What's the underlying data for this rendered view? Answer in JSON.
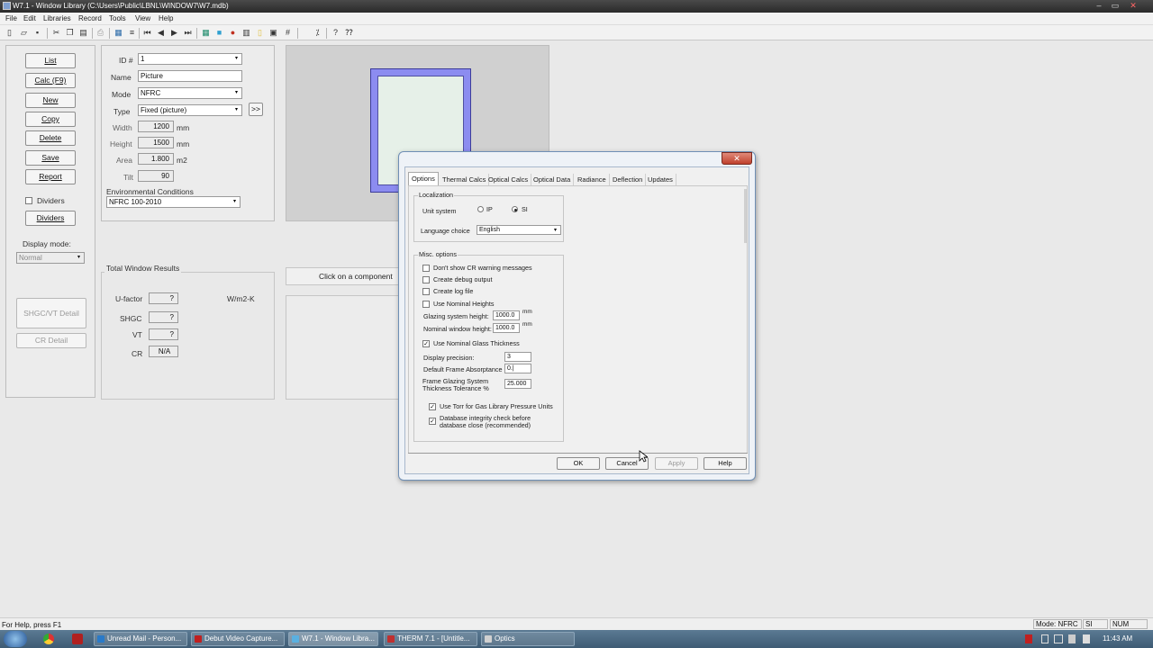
{
  "window": {
    "title": "W7.1 - Window Library (C:\\Users\\Public\\LBNL\\WINDOW7\\W7.mdb)"
  },
  "menu": [
    "File",
    "Edit",
    "Libraries",
    "Record",
    "Tools",
    "View",
    "Help"
  ],
  "toolbar": {
    "icons": [
      "new-icon",
      "open-icon",
      "save-icon",
      "cut-icon",
      "copy-icon",
      "paste-icon",
      "print-icon",
      "grid-icon",
      "list-icon",
      "first-icon",
      "prev-icon",
      "next-icon",
      "last-icon",
      "table-icon",
      "square-icon",
      "red-dot-icon",
      "bars-icon",
      "page-icon",
      "frame-icon",
      "hash-icon",
      "percent-icon",
      "help-icon",
      "context-help-icon"
    ]
  },
  "left_buttons": {
    "list": "List",
    "calc": "Calc (F9)",
    "new": "New",
    "copy": "Copy",
    "delete": "Delete",
    "save": "Save",
    "report": "Report",
    "dividers_check": "Dividers",
    "dividers": "Dividers",
    "display_mode_label": "Display mode:",
    "display_mode": "Normal",
    "shgc": "SHGC/VT Detail",
    "cr": "CR Detail"
  },
  "record": {
    "id_label": "ID #",
    "id": "1",
    "name_label": "Name",
    "name": "Picture",
    "mode_label": "Mode",
    "mode": "NFRC",
    "type_label": "Type",
    "type": "Fixed (picture)",
    "more": ">>",
    "width_label": "Width",
    "width": "1200",
    "width_unit": "mm",
    "height_label": "Height",
    "height": "1500",
    "height_unit": "mm",
    "area_label": "Area",
    "area": "1.800",
    "area_unit": "m2",
    "tilt_label": "Tilt",
    "tilt": "90",
    "env_label": "Environmental Conditions",
    "env": "NFRC 100-2010"
  },
  "results": {
    "title": "Total Window Results",
    "u_label": "U-factor",
    "u": "?",
    "unit": "W/m2-K",
    "shgc_label": "SHGC",
    "shgc": "?",
    "vt_label": "VT",
    "vt": "?",
    "cr_label": "CR",
    "cr": "N/A"
  },
  "component_hint": "Click on a component",
  "dialog": {
    "close": "✕",
    "tabs": [
      "Options",
      "Thermal Calcs",
      "Optical Calcs",
      "Optical Data",
      "Radiance",
      "Deflection",
      "Updates"
    ],
    "localization": "Localization",
    "unit_system": "Unit system",
    "ip": "IP",
    "si": "SI",
    "lang_label": "Language choice",
    "lang": "English",
    "misc": "Misc. options",
    "chk_cr": "Don't show CR warning messages",
    "chk_debug": "Create debug output",
    "chk_log": "Create log file",
    "chk_nom": "Use Nominal Heights",
    "gsh_label": "Glazing system height:",
    "gsh": "1000.0",
    "gsh_unit": "mm",
    "nwh_label": "Nominal window height:",
    "nwh": "1000.0",
    "nwh_unit": "mm",
    "chk_glass": "Use Nominal Glass Thickness",
    "prec_label": "Display precision:",
    "prec": "3",
    "dfa_label": "Default Frame Absorptance",
    "dfa": "0.|",
    "fgs_label1": "Frame Glazing System",
    "fgs_label2": "Thickness Tolerance %",
    "fgs": "25.000",
    "chk_torr": "Use Torr for Gas Library Pressure Units",
    "chk_db1": "Database integrity check before",
    "chk_db2": "database close (recommended)",
    "ok": "OK",
    "cancel": "Cancel",
    "apply": "Apply",
    "help": "Help"
  },
  "status": {
    "left": "For Help, press F1",
    "mode": "Mode: NFRC",
    "si": "SI",
    "num": "NUM"
  },
  "taskbar": {
    "tasks": [
      "Unread Mail - Person...",
      "Debut Video Capture...",
      "W7.1 - Window Libra...",
      "THERM 7.1 - [Untitle...",
      "Optics"
    ],
    "time": "11:43 AM"
  }
}
